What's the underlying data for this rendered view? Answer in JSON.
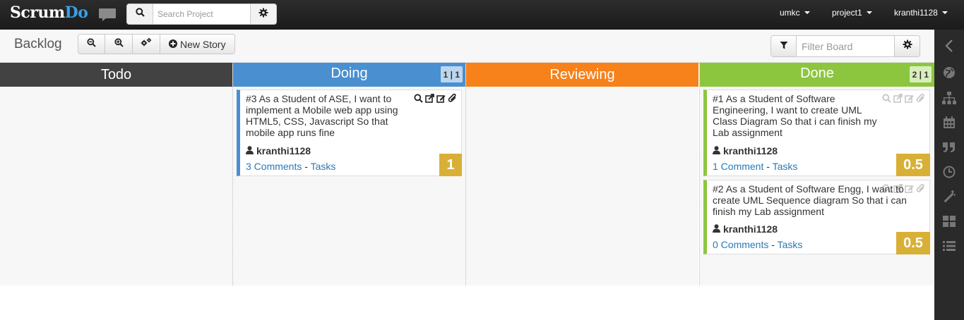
{
  "header": {
    "logo_part1": "Scrum",
    "logo_part2": "Do",
    "search_placeholder": "Search Project",
    "menus": [
      {
        "label": "umkc"
      },
      {
        "label": "project1"
      },
      {
        "label": "kranthi1128"
      }
    ]
  },
  "toolbar": {
    "title": "Backlog",
    "new_story_label": "New Story",
    "filter_placeholder": "Filter Board"
  },
  "colors": {
    "todo": "#424242",
    "doing": "#4a8fd0",
    "reviewing": "#f7811a",
    "done": "#8cc63f",
    "points": "#d8b036",
    "link": "#2a79b6"
  },
  "columns": [
    {
      "title": "Todo",
      "count": ""
    },
    {
      "title": "Doing",
      "count": "1 | 1"
    },
    {
      "title": "Reviewing",
      "count": ""
    },
    {
      "title": "Done",
      "count": "2 | 1"
    }
  ],
  "cards": {
    "doing": [
      {
        "text": "#3 As a Student of ASE, I want to implement a Mobile web app using HTML5, CSS, Javascript So that mobile app runs fine",
        "owner": "kranthi1128",
        "comments": "3 Comments",
        "tasks": "Tasks",
        "points": "1"
      }
    ],
    "done": [
      {
        "text": "#1 As a Student of Software Engineering, I want to create UML Class Diagram So that i can finish my Lab assignment",
        "owner": "kranthi1128",
        "comments": "1 Comment",
        "tasks": "Tasks",
        "points": "0.5"
      },
      {
        "text": "#2 As a Student of Software Engg, I want to create UML Sequence diagram So that i can finish my Lab assignment",
        "owner": "kranthi1128",
        "comments": "0 Comments",
        "tasks": "Tasks",
        "points": "0.5"
      }
    ]
  },
  "separator": "-",
  "sidebar_icons": [
    "chevron-left-icon",
    "globe-icon",
    "sitemap-icon",
    "calendar-icon",
    "quote-icon",
    "clock-icon",
    "magic-wand-icon",
    "grid-icon",
    "list-icon"
  ]
}
